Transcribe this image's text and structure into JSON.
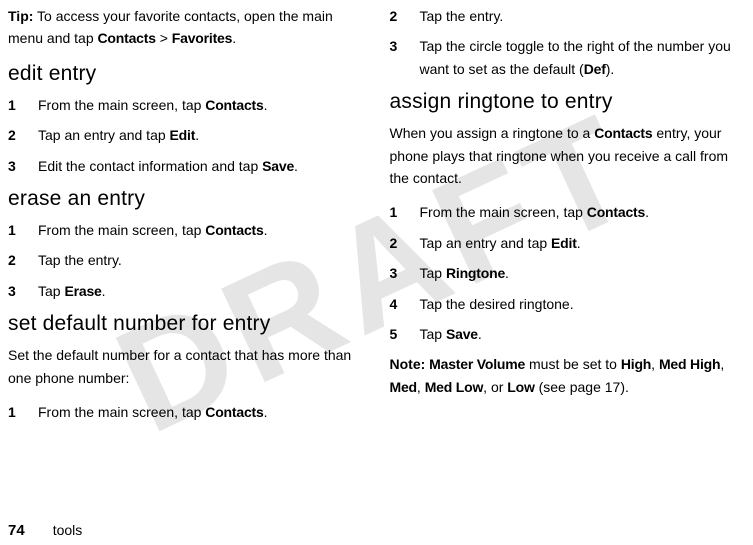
{
  "watermark": "DRAFT",
  "left": {
    "tip_label": "Tip:",
    "tip_text": " To access your favorite contacts, open the main menu and tap ",
    "tip_path_a": "Contacts",
    "tip_path_sep": " > ",
    "tip_path_b": "Favorites",
    "section1": "edit entry",
    "s1_step1_pre": "From the main screen, tap ",
    "s1_step1_bold": "Contacts",
    "s1_step2_pre": "Tap an entry and tap ",
    "s1_step2_bold": "Edit",
    "s1_step3_pre": "Edit the contact information and tap ",
    "s1_step3_bold": "Save",
    "section2": "erase an entry",
    "s2_step1_pre": "From the main screen, tap ",
    "s2_step1_bold": "Contacts",
    "s2_step2_pre": "Tap the entry.",
    "s2_step3_pre": "Tap ",
    "s2_step3_bold": "Erase",
    "section3": "set default number for entry",
    "s3_intro": "Set the default number for a contact that has more than one phone number:",
    "s3_step1_pre": "From the main screen, tap ",
    "s3_step1_bold": "Contacts"
  },
  "right": {
    "r_step2_pre": "Tap the entry.",
    "r_step3_pre": "Tap the circle toggle to the right of the number you want to set as the default (",
    "r_step3_bold": "Def",
    "r_step3_post": ").",
    "section4": "assign ringtone to entry",
    "s4_intro_pre": "When you assign a ringtone to a ",
    "s4_intro_bold": "Contacts",
    "s4_intro_post": " entry, your phone plays that ringtone when you receive a call from the contact.",
    "s4_step1_pre": "From the main screen, tap ",
    "s4_step1_bold": "Contacts",
    "s4_step2_pre": "Tap an entry and tap ",
    "s4_step2_bold": "Edit",
    "s4_step3_pre": "Tap ",
    "s4_step3_bold": "Ringtone",
    "s4_step4_pre": "Tap the desired ringtone.",
    "s4_step5_pre": "Tap ",
    "s4_step5_bold": "Save",
    "note_label": "Note:",
    "note_pre": " ",
    "note_b1": "Master Volume",
    "note_mid1": " must be set to ",
    "note_b2": "High",
    "note_sep1": ", ",
    "note_b3": "Med High",
    "note_sep2": ", ",
    "note_b4": "Med",
    "note_sep3": ", ",
    "note_b5": "Med Low",
    "note_sep4": ", or ",
    "note_b6": "Low",
    "note_post": " (see page 17)."
  },
  "nums": {
    "n1": "1",
    "n2": "2",
    "n3": "3",
    "n4": "4",
    "n5": "5"
  },
  "punct": {
    "period": "."
  },
  "footer": {
    "page": "74",
    "label": "tools"
  }
}
